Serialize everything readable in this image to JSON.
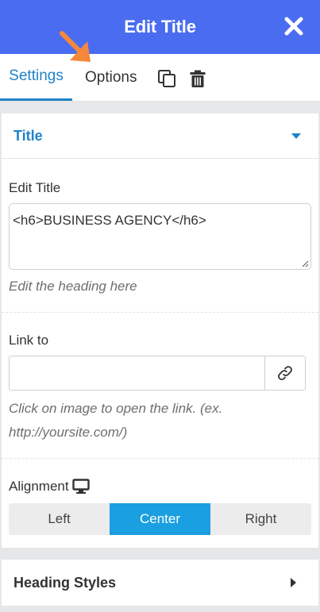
{
  "header": {
    "title": "Edit Title",
    "close_icon": "close-icon"
  },
  "tabs": [
    {
      "label": "Settings",
      "active": true
    },
    {
      "label": "Options",
      "active": false
    }
  ],
  "toolbar": {
    "icons": [
      "copy-icon",
      "trash-icon"
    ]
  },
  "title_panel": {
    "heading": "Title",
    "edit_title": {
      "label": "Edit Title",
      "value": "<h6>BUSINESS AGENCY</h6>",
      "hint": "Edit the heading here"
    },
    "link_to": {
      "label": "Link to",
      "value": "",
      "hint_line1": "Click on image to open the link. (ex.",
      "hint_line2": "http://yoursite.com/)",
      "button_icon": "link-icon"
    },
    "alignment": {
      "label": "Alignment",
      "device_icon": "desktop-icon",
      "options": [
        "Left",
        "Center",
        "Right"
      ],
      "selected": "Center"
    }
  },
  "heading_styles_panel": {
    "heading": "Heading Styles"
  },
  "colors": {
    "header": "#4a6cf0",
    "accent": "#1f82c8",
    "active_segment": "#1a9fe0",
    "annotation_arrow": "#f5883b"
  }
}
